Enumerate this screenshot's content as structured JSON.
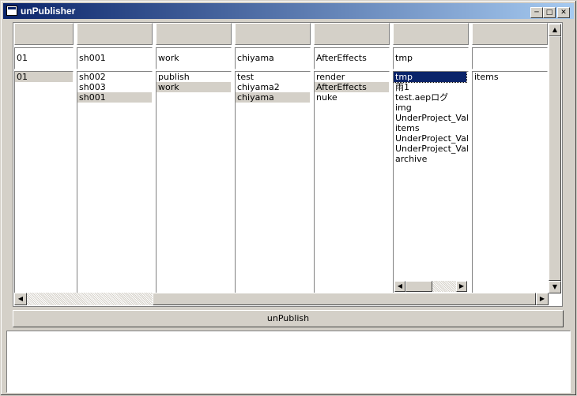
{
  "window": {
    "title": "unPublisher"
  },
  "columns": [
    {
      "path": "01",
      "items": [
        "01"
      ],
      "selected": 0
    },
    {
      "path": "sh001",
      "items": [
        "sh002",
        "sh003",
        "sh001"
      ],
      "selected": 2
    },
    {
      "path": "work",
      "items": [
        "publish",
        "work"
      ],
      "selected": 1
    },
    {
      "path": "chiyama",
      "items": [
        "test",
        "chiyama2",
        "chiyama"
      ],
      "selected": 2
    },
    {
      "path": "AfterEffects",
      "items": [
        "render",
        "AfterEffects",
        "nuke"
      ],
      "selected": 1
    },
    {
      "path": "tmp",
      "items": [
        "tmp",
        "雨1",
        "test.aepログ",
        "img",
        "UnderProject_Vali",
        "items",
        "UnderProject_Vali",
        "UnderProject_Vali",
        "archive"
      ],
      "selected": 0
    },
    {
      "path": "",
      "items": [
        "items"
      ],
      "selected": -1
    }
  ],
  "unpublish_button": "unPublish",
  "log_text": ""
}
